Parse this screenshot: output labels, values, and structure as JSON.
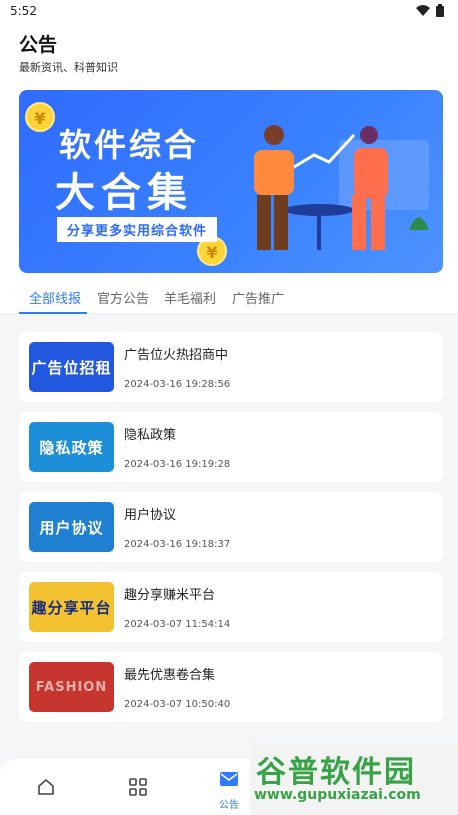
{
  "status": {
    "time": "5:52"
  },
  "header": {
    "title": "公告",
    "subtitle": "最新资讯、科普知识"
  },
  "banner": {
    "line1": "软件综合",
    "line2": "大合集",
    "pill": "分享更多实用综合软件",
    "coin": "¥"
  },
  "tabs": [
    {
      "label": "全部线报",
      "active": true
    },
    {
      "label": "官方公告",
      "active": false
    },
    {
      "label": "羊毛福利",
      "active": false
    },
    {
      "label": "广告推广",
      "active": false
    }
  ],
  "items": [
    {
      "title": "广告位火热招商中",
      "date": "2024-03-16 19:28:56",
      "thumb_text": "广告位招租",
      "thumb_color": "#2257e0"
    },
    {
      "title": "隐私政策",
      "date": "2024-03-16 19:19:28",
      "thumb_text": "隐私政策",
      "thumb_color": "#1d8fd8"
    },
    {
      "title": "用户协议",
      "date": "2024-03-16 19:18:37",
      "thumb_text": "用户协议",
      "thumb_color": "#1f7fd0"
    },
    {
      "title": "趣分享赚米平台",
      "date": "2024-03-07 11:54:14",
      "thumb_text": "趣分享平台",
      "thumb_color": "#f2c230"
    },
    {
      "title": "最先优惠卷合集",
      "date": "2024-03-07 10:50:40",
      "thumb_text": "FASHION",
      "thumb_color": "#c7352f"
    }
  ],
  "nav": {
    "active_label": "公告"
  },
  "watermark": {
    "line1": "谷普软件园",
    "line2": "www.gupuxiazai.com"
  },
  "colors": {
    "accent": "#2f7bff",
    "banner": "#2f6bff"
  }
}
